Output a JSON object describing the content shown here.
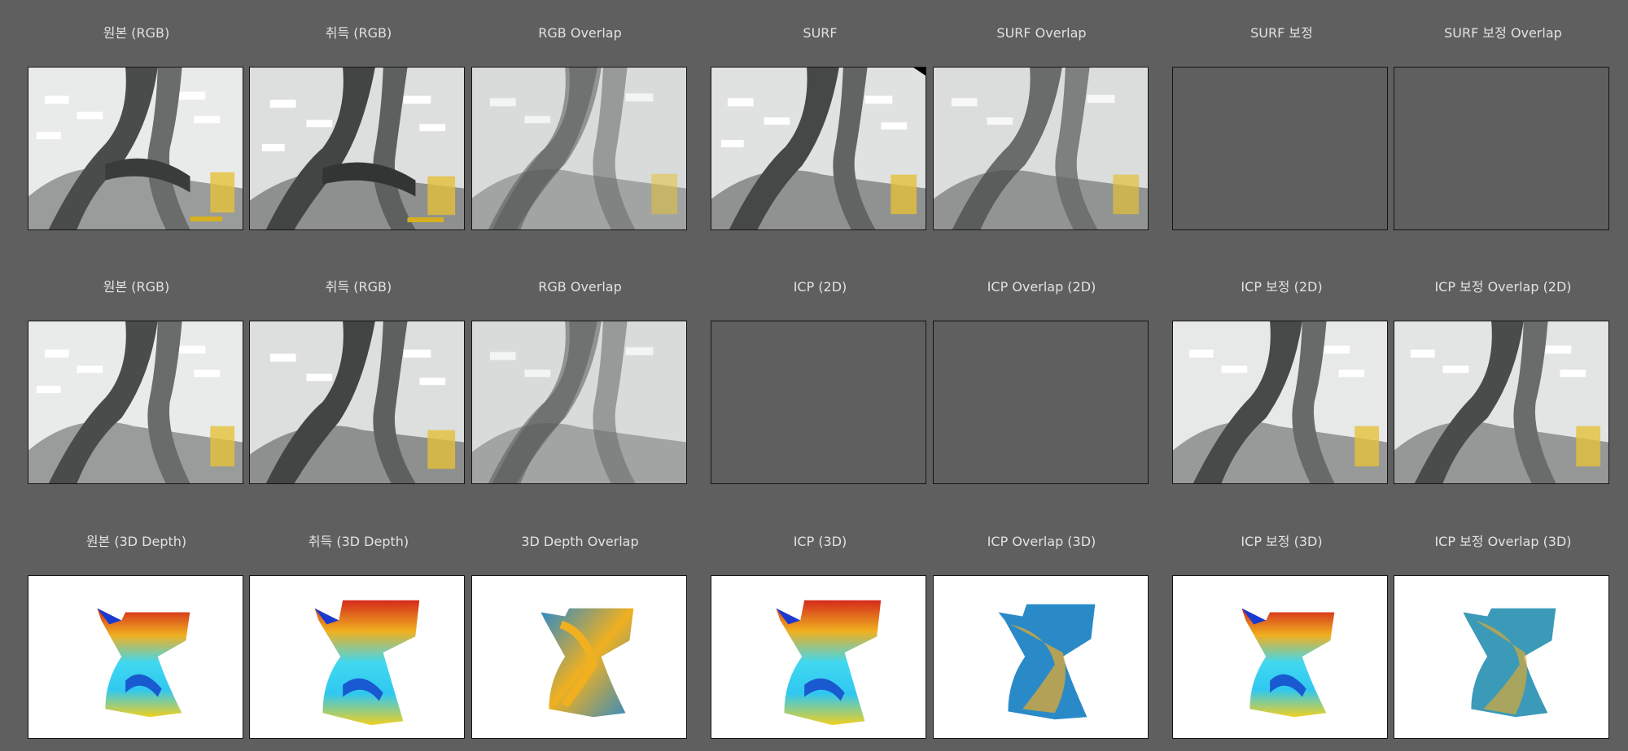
{
  "rows": [
    {
      "labels": [
        "원본 (RGB)",
        "취득 (RGB)",
        "RGB Overlap",
        "SURF",
        "SURF Overlap",
        "SURF 보정",
        "SURF 보정 Overlap"
      ]
    },
    {
      "labels": [
        "원본 (RGB)",
        "취득  (RGB)",
        "RGB Overlap",
        "ICP (2D)",
        "ICP Overlap (2D)",
        "ICP 보정 (2D)",
        "ICP 보정 Overlap (2D)"
      ]
    },
    {
      "labels": [
        "원본 (3D Depth)",
        "취득 (3D Depth)",
        "3D Depth Overlap",
        "ICP (3D)",
        "ICP Overlap (3D)",
        "ICP 보정 (3D)",
        "ICP 보정 Overlap (3D)"
      ]
    }
  ],
  "colors": {
    "background": "#5f5f5f",
    "label_text": "#e2e2e2",
    "panel_border": "#151515"
  }
}
